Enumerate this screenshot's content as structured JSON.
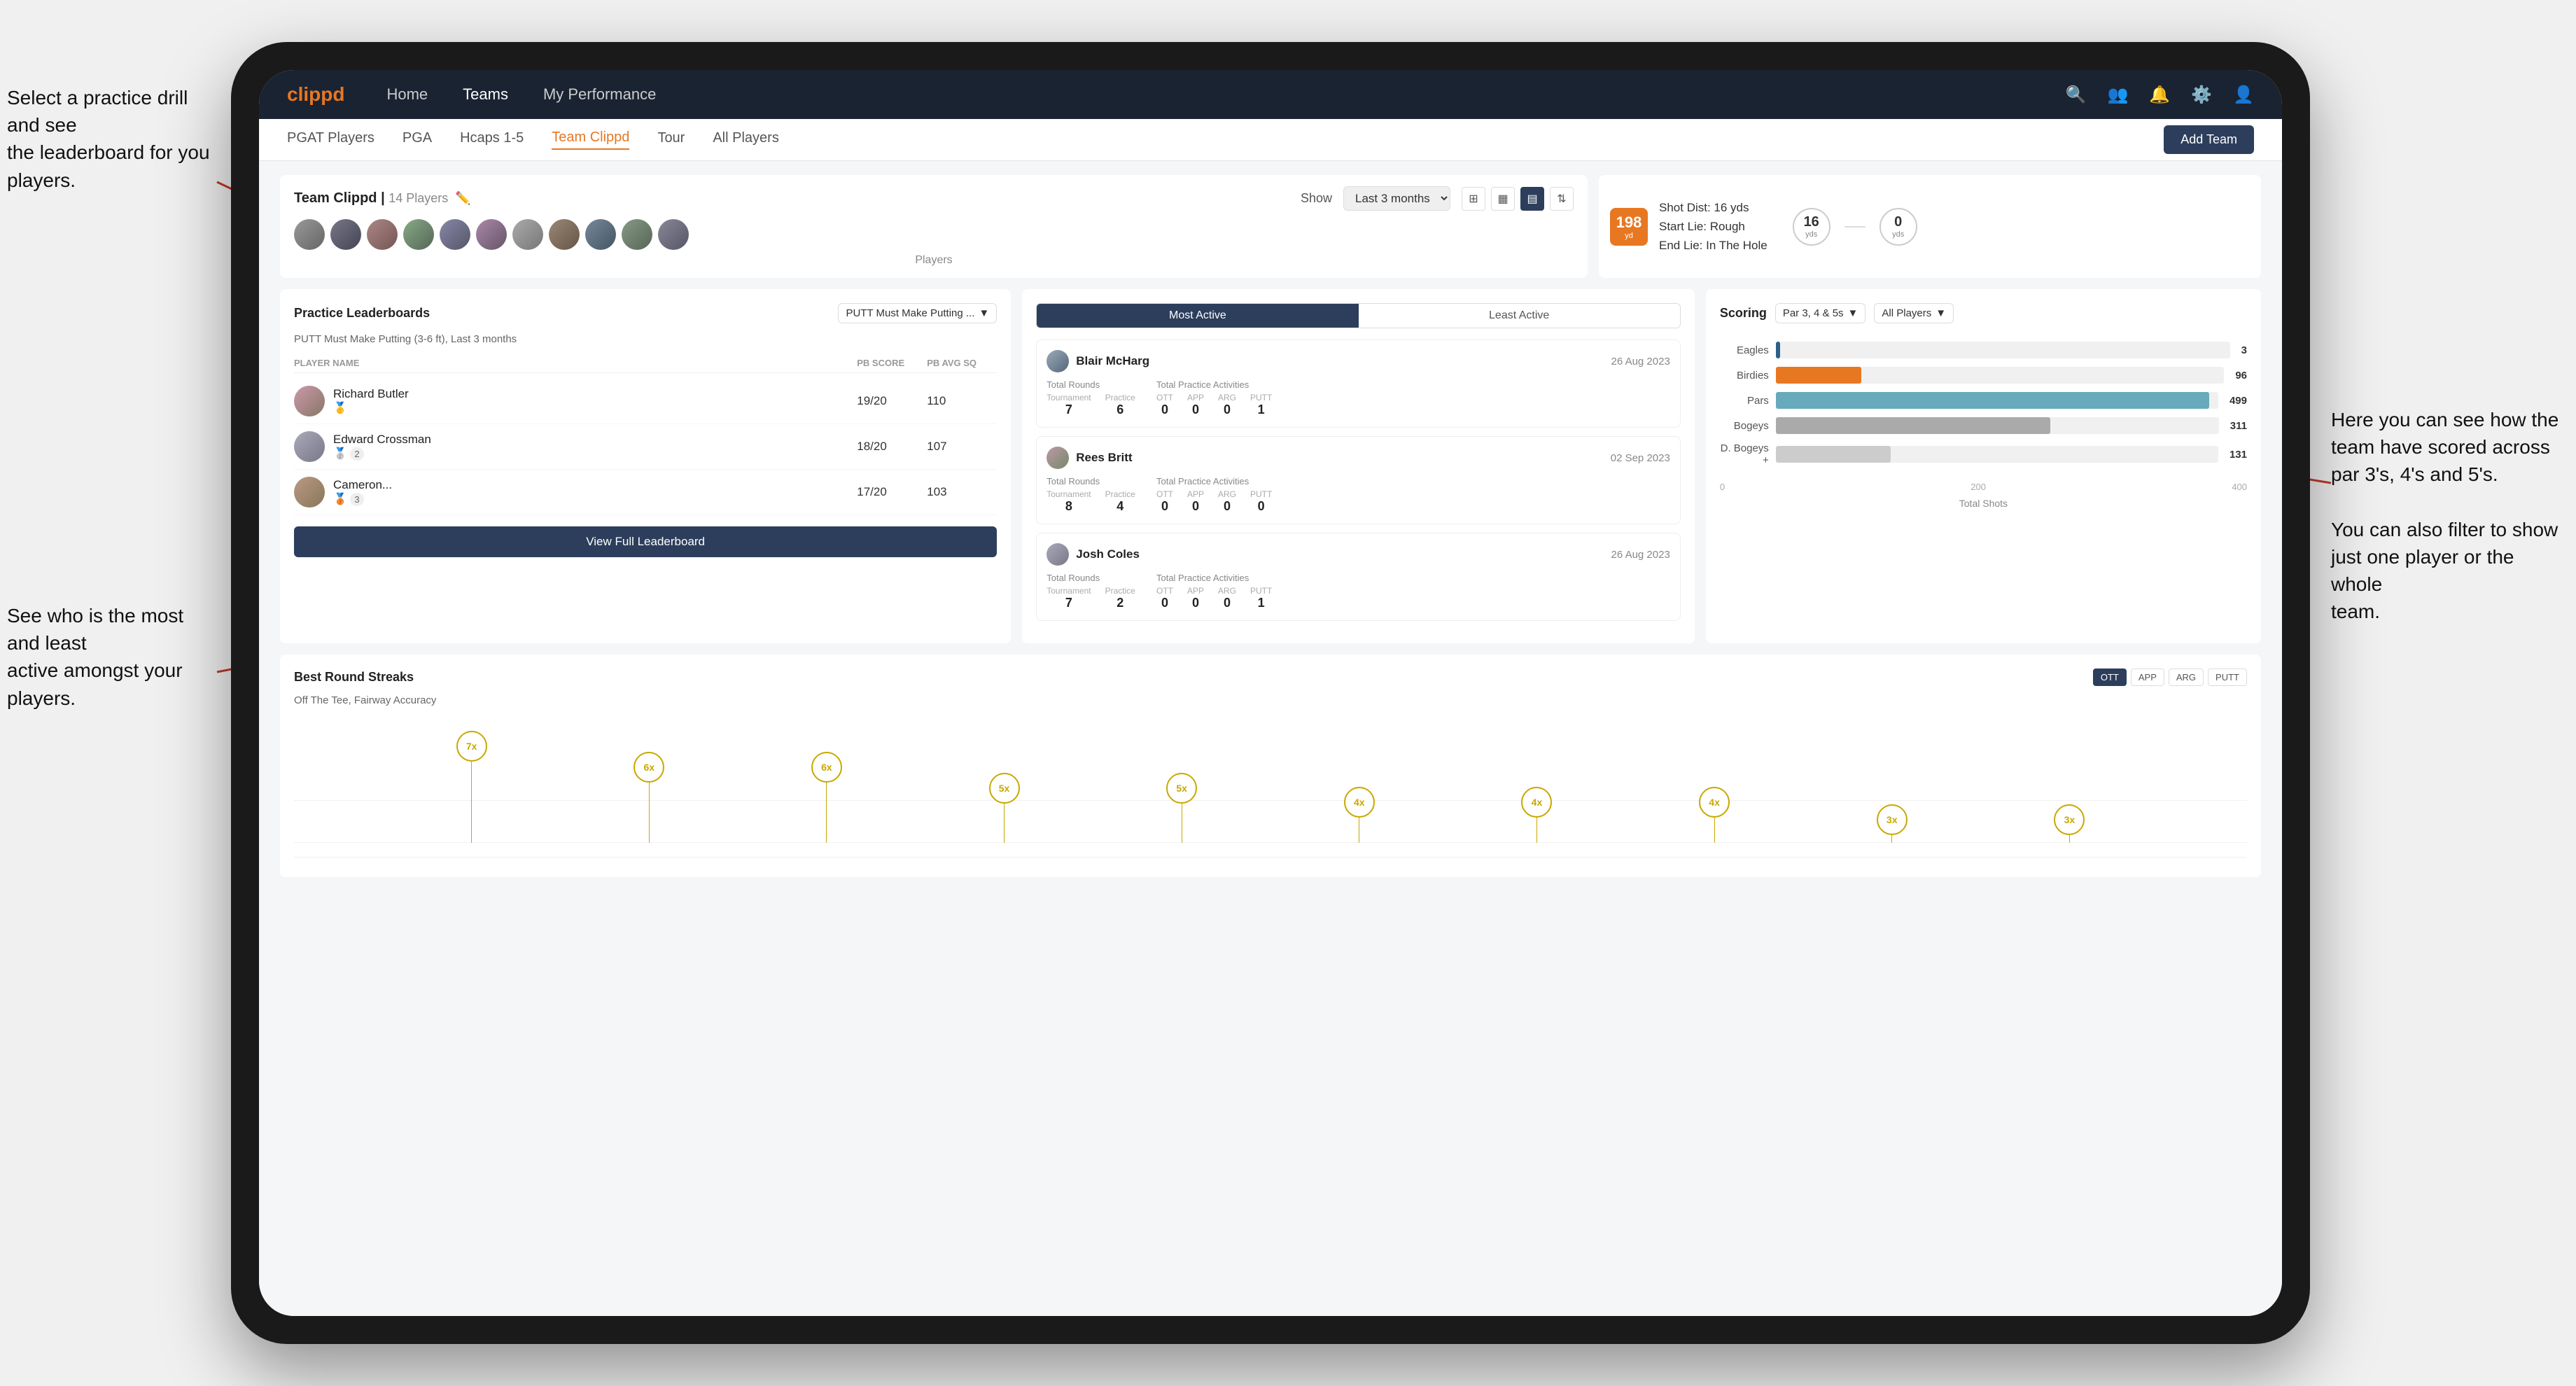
{
  "annotations": {
    "top_left": "Select a practice drill and see\nthe leaderboard for you players.",
    "bottom_left": "See who is the most and least\nactive amongst your players.",
    "right": "Here you can see how the\nteam have scored across\npar 3's, 4's and 5's.\n\nYou can also filter to show\njust one player or the whole\nteam."
  },
  "nav": {
    "logo": "clippd",
    "links": [
      "Home",
      "Teams",
      "My Performance"
    ],
    "active": "Teams"
  },
  "sub_nav": {
    "links": [
      "PGAT Players",
      "PGA",
      "Hcaps 1-5",
      "Team Clippd",
      "Tour",
      "All Players"
    ],
    "active": "Team Clippd",
    "add_team": "Add Team"
  },
  "team_info": {
    "name": "Team Clippd",
    "player_count": "14 Players",
    "players_label": "Players",
    "show_label": "Show",
    "show_period": "Last 3 months"
  },
  "shot_card": {
    "distance": "198",
    "distance_unit": "yd",
    "shot_dist_label": "Shot Dist: 16 yds",
    "start_lie": "Start Lie: Rough",
    "end_lie": "End Lie: In The Hole",
    "yds_1": "16",
    "yds_1_label": "yds",
    "yds_2": "0",
    "yds_2_label": "yds"
  },
  "practice_leaderboard": {
    "title": "Practice Leaderboards",
    "filter": "PUTT Must Make Putting ...",
    "sub_title": "PUTT Must Make Putting (3-6 ft), Last 3 months",
    "columns": [
      "PLAYER NAME",
      "PB SCORE",
      "PB AVG SQ"
    ],
    "players": [
      {
        "name": "Richard Butler",
        "score": "19/20",
        "avg": "110",
        "medal": "🥇",
        "rank": null
      },
      {
        "name": "Edward Crossman",
        "score": "18/20",
        "avg": "107",
        "medal": "🥈",
        "rank": "2"
      },
      {
        "name": "Cameron...",
        "score": "17/20",
        "avg": "103",
        "medal": "🥉",
        "rank": "3"
      }
    ],
    "view_button": "View Full Leaderboard"
  },
  "activity": {
    "tabs": [
      "Most Active",
      "Least Active"
    ],
    "active_tab": "Most Active",
    "players": [
      {
        "name": "Blair McHarg",
        "date": "26 Aug 2023",
        "total_rounds_label": "Total Rounds",
        "tournament": "7",
        "practice": "6",
        "practice_activities_label": "Total Practice Activities",
        "ott": "0",
        "app": "0",
        "arg": "0",
        "putt": "1"
      },
      {
        "name": "Rees Britt",
        "date": "02 Sep 2023",
        "total_rounds_label": "Total Rounds",
        "tournament": "8",
        "practice": "4",
        "practice_activities_label": "Total Practice Activities",
        "ott": "0",
        "app": "0",
        "arg": "0",
        "putt": "0"
      },
      {
        "name": "Josh Coles",
        "date": "26 Aug 2023",
        "total_rounds_label": "Total Rounds",
        "tournament": "7",
        "practice": "2",
        "practice_activities_label": "Total Practice Activities",
        "ott": "0",
        "app": "0",
        "arg": "0",
        "putt": "1"
      }
    ]
  },
  "scoring": {
    "title": "Scoring",
    "filter1": "Par 3, 4 & 5s",
    "filter2": "All Players",
    "bars": [
      {
        "label": "Eagles",
        "value": 3,
        "max": 500,
        "color": "#2c5f8a"
      },
      {
        "label": "Birdies",
        "value": 96,
        "max": 500,
        "color": "#e87722"
      },
      {
        "label": "Pars",
        "value": 499,
        "max": 500,
        "color": "#4a9b6f"
      },
      {
        "label": "Bogeys",
        "value": 311,
        "max": 500,
        "color": "#aaaaaa"
      },
      {
        "label": "D. Bogeys +",
        "value": 131,
        "max": 500,
        "color": "#cccccc"
      }
    ],
    "axis_labels": [
      "0",
      "200",
      "400"
    ],
    "total_shots_label": "Total Shots"
  },
  "streaks": {
    "title": "Best Round Streaks",
    "buttons": [
      "OTT",
      "APP",
      "ARG",
      "PUTT"
    ],
    "active_button": "OTT",
    "subtitle": "Off The Tee, Fairway Accuracy",
    "dots": [
      {
        "label": "7x",
        "height": 160
      },
      {
        "label": "6x",
        "height": 130
      },
      {
        "label": "6x",
        "height": 130
      },
      {
        "label": "5x",
        "height": 100
      },
      {
        "label": "5x",
        "height": 100
      },
      {
        "label": "4x",
        "height": 80
      },
      {
        "label": "4x",
        "height": 80
      },
      {
        "label": "4x",
        "height": 80
      },
      {
        "label": "3x",
        "height": 55
      },
      {
        "label": "3x",
        "height": 55
      }
    ]
  },
  "avatars": [
    1,
    2,
    3,
    4,
    5,
    6,
    7,
    8,
    9,
    10,
    11
  ]
}
